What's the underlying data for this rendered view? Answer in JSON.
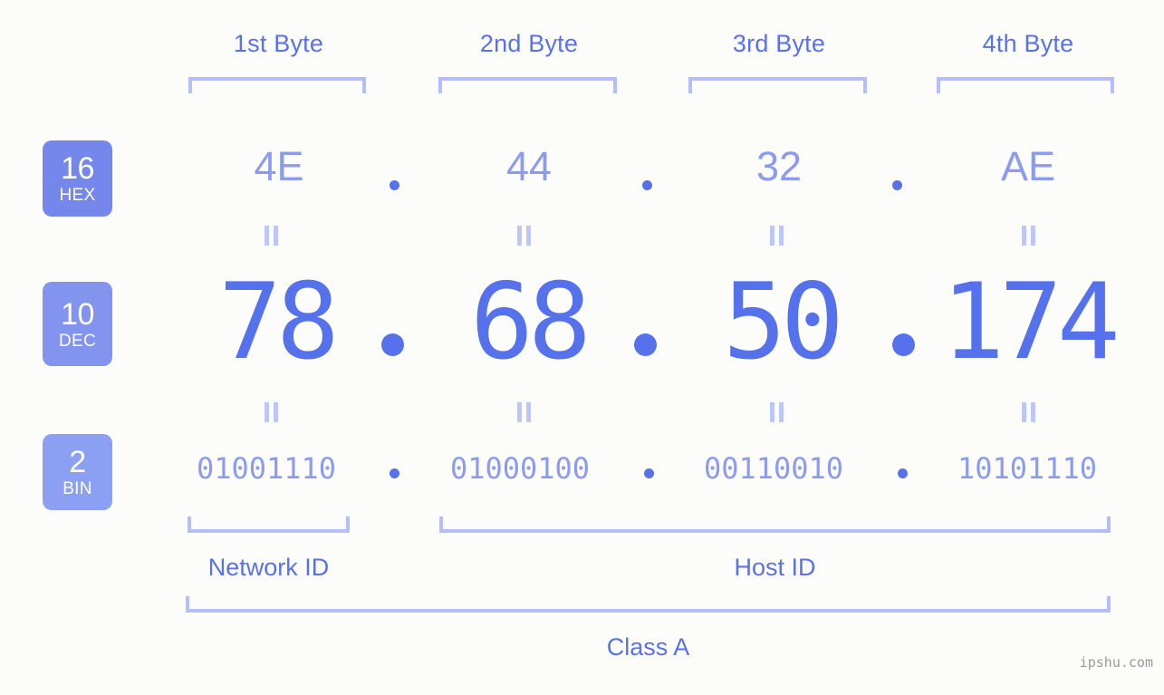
{
  "meta": {
    "background_color": "#fcfdfa",
    "accent_color": "#5571ec",
    "light_accent_color": "#8b9bef",
    "bracket_color": "#b3befa",
    "badge_color": "#7e8eeb"
  },
  "byte_headers": [
    {
      "label": "1st Byte"
    },
    {
      "label": "2nd Byte"
    },
    {
      "label": "3rd Byte"
    },
    {
      "label": "4th Byte"
    }
  ],
  "bases": [
    {
      "number": "16",
      "abbr": "HEX"
    },
    {
      "number": "10",
      "abbr": "DEC"
    },
    {
      "number": "2",
      "abbr": "BIN"
    }
  ],
  "rows": {
    "hex": {
      "values": [
        "4E",
        "44",
        "32",
        "AE"
      ],
      "separator": "."
    },
    "dec": {
      "values": [
        "78",
        "68",
        "50",
        "174"
      ],
      "separator": "."
    },
    "bin": {
      "values": [
        "01001110",
        "01000100",
        "00110010",
        "10101110"
      ],
      "separator": "."
    }
  },
  "equality_markers": {
    "glyph": "="
  },
  "sections": [
    {
      "label": "Network ID"
    },
    {
      "label": "Host ID"
    }
  ],
  "class": {
    "label": "Class A"
  },
  "watermark": {
    "text": "ipshu.com"
  }
}
